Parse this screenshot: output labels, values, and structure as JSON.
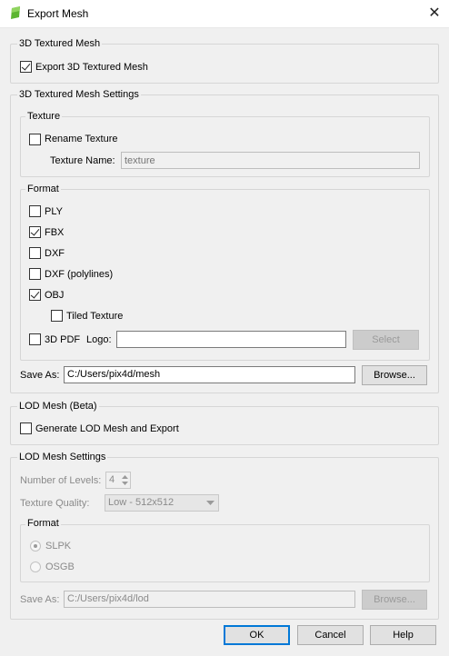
{
  "window": {
    "title": "Export Mesh",
    "icon": "app-logo-icon",
    "close_glyph": "✕"
  },
  "textured_mesh": {
    "group_title": "3D Textured Mesh",
    "export_label": "Export 3D Textured Mesh",
    "export_checked": true
  },
  "settings": {
    "group_title": "3D Textured Mesh Settings",
    "texture": {
      "group_title": "Texture",
      "rename_label": "Rename Texture",
      "rename_checked": false,
      "name_label": "Texture Name:",
      "name_placeholder": "texture"
    },
    "format": {
      "group_title": "Format",
      "ply": "PLY",
      "fbx": "FBX",
      "dxf": "DXF",
      "dxf_polylines": "DXF (polylines)",
      "obj": "OBJ",
      "tiled_texture": "Tiled Texture",
      "pdf3d": "3D PDF",
      "logo_label": "Logo:",
      "logo_value": "",
      "select_button": "Select",
      "checked": {
        "ply": false,
        "fbx": true,
        "dxf": false,
        "dxf_polylines": false,
        "obj": true,
        "tiled_texture": false,
        "pdf3d": false
      }
    },
    "save_as_label": "Save As:",
    "save_as_value": "C:/Users/pix4d/mesh",
    "browse_button": "Browse..."
  },
  "lod_mesh": {
    "group_title": "LOD Mesh (Beta)",
    "generate_label": "Generate LOD Mesh and Export",
    "generate_checked": false
  },
  "lod_settings": {
    "group_title": "LOD Mesh Settings",
    "levels_label": "Number of Levels:",
    "levels_value": "4",
    "quality_label": "Texture Quality:",
    "quality_value": "Low - 512x512",
    "format": {
      "group_title": "Format",
      "slpk": "SLPK",
      "osgb": "OSGB",
      "selected": "SLPK"
    },
    "save_as_label": "Save As:",
    "save_as_value": "C:/Users/pix4d/lod",
    "browse_button": "Browse..."
  },
  "buttons": {
    "ok": "OK",
    "cancel": "Cancel",
    "help": "Help"
  },
  "colors": {
    "accent": "#0078d7",
    "logo_green": "#5cb531"
  }
}
